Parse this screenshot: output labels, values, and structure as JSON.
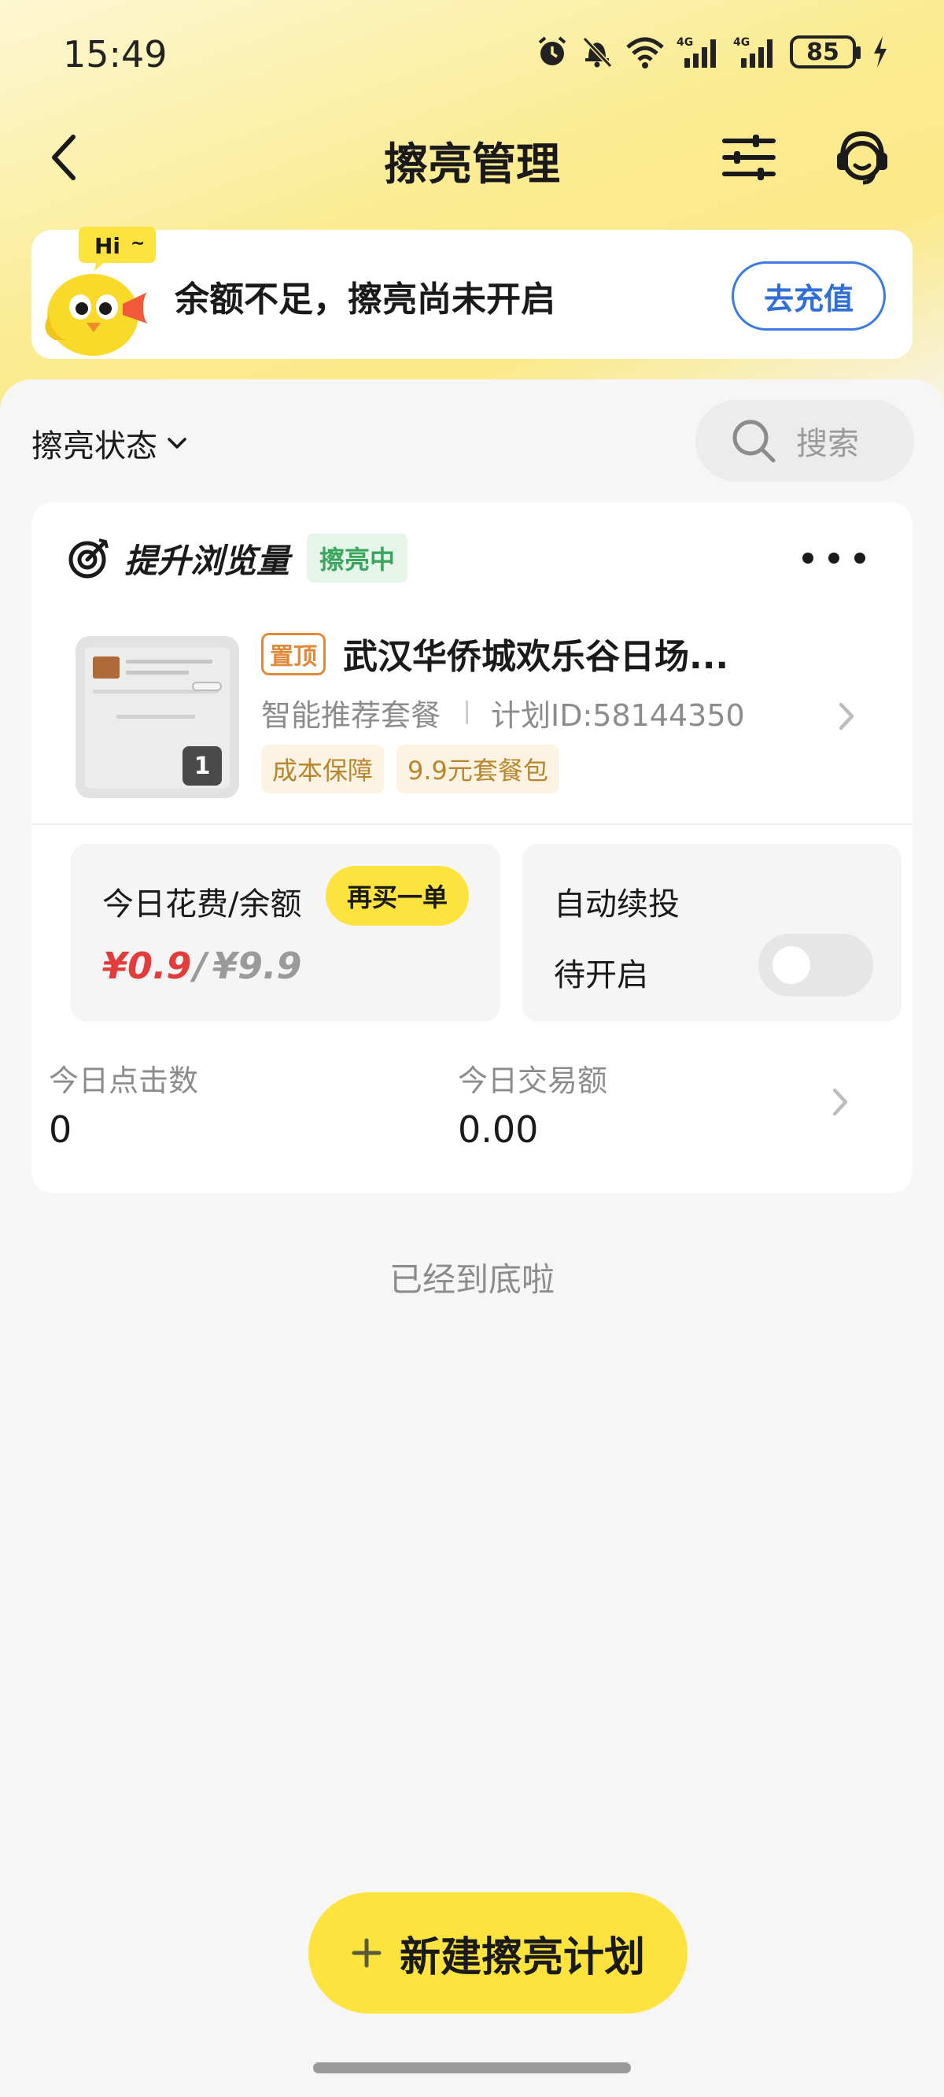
{
  "status_bar": {
    "time": "15:49",
    "battery": "85",
    "icons": [
      "alarm-icon",
      "mute-icon",
      "wifi-icon",
      "signal-4g-icon",
      "signal-4g-icon",
      "battery-icon",
      "charging-icon"
    ]
  },
  "nav": {
    "title": "擦亮管理",
    "back_icon": "back-arrow-icon",
    "filter_icon": "filter-sliders-icon",
    "service_icon": "customer-service-icon"
  },
  "alert": {
    "badge": "Hi",
    "message": "余额不足，擦亮尚未开启",
    "button": "去充值"
  },
  "filters": {
    "status_label": "擦亮状态",
    "search_placeholder": "搜索"
  },
  "plan": {
    "goal": "提升浏览量",
    "status": "擦亮中",
    "thumb_count": "1",
    "top_tag": "置顶",
    "title": "武汉华侨城欢乐谷日场...",
    "package": "智能推荐套餐",
    "plan_id": "计划ID:58144350",
    "tags": [
      "成本保障",
      "9.9元套餐包"
    ],
    "spend_label": "今日花费/余额",
    "rebuy_button": "再买一单",
    "spend_today": "¥0.9",
    "spend_separator": "/",
    "spend_balance": "¥9.9",
    "renew_label": "自动续投",
    "renew_status": "待开启",
    "renew_enabled": false,
    "clicks_label": "今日点击数",
    "clicks_value": "0",
    "gmv_label": "今日交易额",
    "gmv_value": "0.00"
  },
  "list_end": "已经到底啦",
  "new_plan_button": "新建擦亮计划",
  "colors": {
    "accent_yellow": "#fce33d",
    "link_blue": "#2f6fd6",
    "price_red": "#e23c3c",
    "status_green": "#3aa55c"
  }
}
